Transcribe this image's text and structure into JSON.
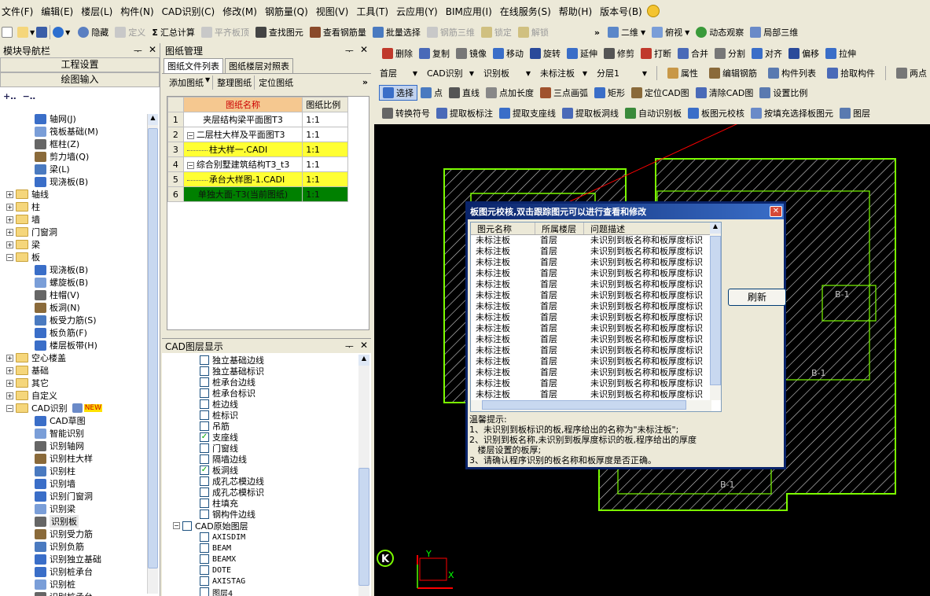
{
  "menu": [
    "文件(F)",
    "编辑(E)",
    "楼层(L)",
    "构件(N)",
    "CAD识别(C)",
    "修改(M)",
    "钢筋量(Q)",
    "视图(V)",
    "工具(T)",
    "云应用(Y)",
    "BIM应用(I)",
    "在线服务(S)",
    "帮助(H)",
    "版本号(B)"
  ],
  "toolbar1": {
    "hide": "隐藏",
    "define": "定义",
    "summary": "汇总计算",
    "flat_board": "平齐板顶",
    "find": "查找图元",
    "view_rebar": "查看钢筋量",
    "batch": "批量选择",
    "rebar3d": "钢筋三维",
    "lock": "锁定",
    "unlock": "解锁",
    "view2d": "二维",
    "topview": "俯视",
    "dynamic": "动态观察",
    "local3d": "局部三维"
  },
  "nav": {
    "title": "模块导航栏",
    "project": "工程设置",
    "draw": "绘图输入",
    "items": [
      "轴网(J)",
      "筏板基础(M)",
      "框柱(Z)",
      "剪力墙(Q)",
      "梁(L)",
      "现浇板(B)",
      "轴线",
      "柱",
      "墙",
      "门窗洞",
      "梁",
      "板",
      "现浇板(B)",
      "螺旋板(B)",
      "柱帽(V)",
      "板洞(N)",
      "板受力筋(S)",
      "板负筋(F)",
      "楼层板带(H)",
      "空心楼盖",
      "基础",
      "其它",
      "自定义",
      "CAD识别",
      "CAD草图",
      "智能识别",
      "识别轴网",
      "识别柱大样",
      "识别柱",
      "识别墙",
      "识别门窗洞",
      "识别梁",
      "识别板",
      "识别受力筋",
      "识别负筋",
      "识别独立基础",
      "识别桩承台",
      "识别桩",
      "识别桩承台"
    ],
    "new_badge": "NEW"
  },
  "drawing": {
    "title": "图纸管理",
    "tab1": "图纸文件列表",
    "tab2": "图纸楼层对照表",
    "add": "添加图纸",
    "arrange": "整理图纸",
    "locate": "定位图纸",
    "headers": [
      "图纸名称",
      "图纸比例"
    ],
    "rows": [
      {
        "n": "1",
        "name": "夹层结构梁平面图T3",
        "scale": "1:1"
      },
      {
        "n": "2",
        "name": "二层柱大样及平面图T3",
        "scale": "1:1"
      },
      {
        "n": "3",
        "name": "柱大样一.CADI",
        "scale": "1:1"
      },
      {
        "n": "4",
        "name": "综合别墅建筑结构T3_t3",
        "scale": "1:1"
      },
      {
        "n": "5",
        "name": "承台大样图-1.CADI",
        "scale": "1:1"
      },
      {
        "n": "6",
        "name": "单独大面-T3(当前图纸)",
        "scale": "1:1"
      }
    ]
  },
  "layers": {
    "title": "CAD图层显示",
    "items": [
      {
        "t": "独立基础边线",
        "c": false
      },
      {
        "t": "独立基础标识",
        "c": false
      },
      {
        "t": "桩承台边线",
        "c": false
      },
      {
        "t": "桩承台标识",
        "c": false
      },
      {
        "t": "桩边线",
        "c": false
      },
      {
        "t": "桩标识",
        "c": false
      },
      {
        "t": "吊筋",
        "c": false
      },
      {
        "t": "支座线",
        "c": true
      },
      {
        "t": "门窗线",
        "c": false
      },
      {
        "t": "隔墙边线",
        "c": false
      },
      {
        "t": "板洞线",
        "c": true
      },
      {
        "t": "成孔芯模边线",
        "c": false
      },
      {
        "t": "成孔芯模标识",
        "c": false
      },
      {
        "t": "柱填充",
        "c": false
      },
      {
        "t": "钢构件边线",
        "c": false
      }
    ],
    "group": "CAD原始图层",
    "orig": [
      "AXISDIM",
      "BEAM",
      "BEAMX",
      "DOTE",
      "AXISTAG",
      "图层4"
    ]
  },
  "toolbar2": [
    "删除",
    "复制",
    "镜像",
    "移动",
    "旋转",
    "延伸",
    "修剪",
    "打断",
    "合并",
    "分割",
    "对齐",
    "偏移",
    "拉伸"
  ],
  "toolbar3": {
    "floor": "首层",
    "cad": "CAD识别",
    "board": "识别板",
    "unmarked": "未标注板",
    "layer": "分层1",
    "attr": "属性",
    "edit_rebar": "编辑钢筋",
    "comp_list": "构件列表",
    "pick": "拾取构件",
    "twopoint": "两点"
  },
  "toolbar4": [
    "选择",
    "点",
    "直线",
    "点加长度",
    "三点画弧",
    "矩形",
    "定位CAD图",
    "清除CAD图",
    "设置比例"
  ],
  "toolbar5": [
    "转换符号",
    "提取板标注",
    "提取支座线",
    "提取板洞线",
    "自动识别板",
    "板图元校核",
    "按填充选择板图元",
    "图层"
  ],
  "dialog": {
    "title": "板图元校核,双击跟踪图元可以进行查看和修改",
    "headers": [
      "图元名称",
      "所属楼层",
      "问题描述"
    ],
    "row": {
      "name": "未标注板",
      "floor": "首层",
      "desc": "未识别到板名称和板厚度标识"
    },
    "count": 15,
    "refresh": "刷新",
    "tips": [
      "温馨提示:",
      "1、未识别到板标识的板,程序给出的名称为\"未标注板\";",
      "2、识别到板名称,未识别到板厚度标识的板,程序给出的厚度",
      "   楼层设置的板厚;",
      "3、请确认程序识别的板名称和板厚度是否正确。"
    ]
  },
  "canvas": {
    "labels": [
      "B-1",
      "B-1",
      "B-1"
    ],
    "axis_y": "Y",
    "axis_x": "X",
    "compass": "K"
  }
}
